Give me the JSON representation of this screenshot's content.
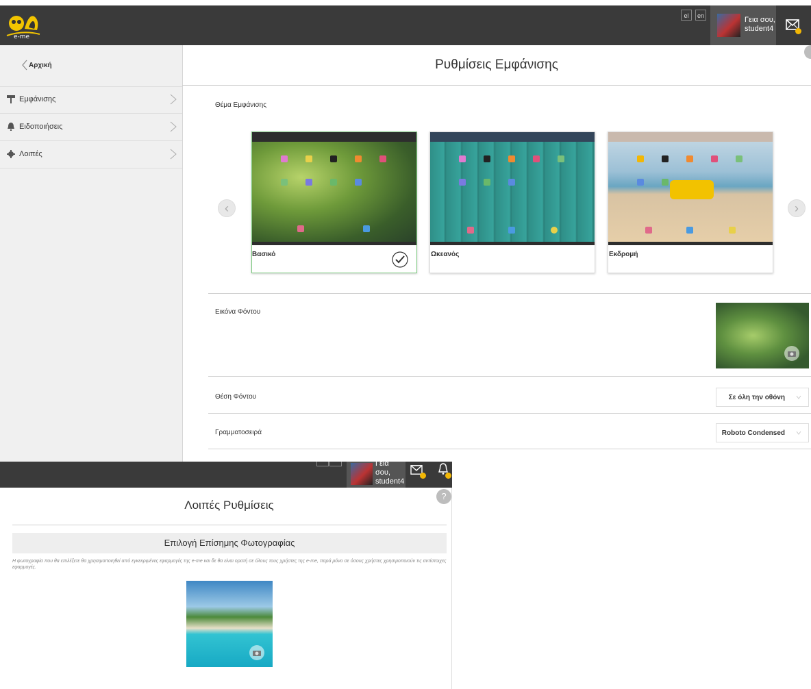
{
  "top_screen": {
    "logo_text": "e-me",
    "lang_buttons": [
      "el",
      "en"
    ],
    "user_greeting_line1": "Γεια σου,",
    "user_greeting_line2": "student4",
    "sidebar": {
      "back_label": "Αρχική",
      "items": [
        {
          "label": "Εμφάνισης",
          "icon": "paint-roller-icon"
        },
        {
          "label": "Ειδοποιήσεις",
          "icon": "bell-icon"
        },
        {
          "label": "Λοιπές",
          "icon": "gear-icon"
        }
      ]
    },
    "page_title": "Ρυθμίσεις Εμφάνισης",
    "theme_section_label": "Θέμα Εμφάνισης",
    "themes": [
      {
        "name": "Βασικό",
        "selected": true
      },
      {
        "name": "Ωκεανός",
        "selected": false
      },
      {
        "name": "Εκδρομή",
        "selected": false
      }
    ],
    "background_image_label": "Εικόνα Φόντου",
    "background_position_label": "Θέση Φόντου",
    "background_position_value": "Σε όλη την οθόνη",
    "font_label": "Γραμματοσειρά",
    "font_value": "Roboto Condensed"
  },
  "bottom_screen": {
    "user_greeting_line1": "Γεια σου,",
    "user_greeting_line2": "student4",
    "page_title": "Λοιπές Ρυθμίσεις",
    "help_symbol": "?",
    "official_photo_header": "Επιλογή Επίσημης Φωτογραφίας",
    "official_photo_description": "Η φωτογραφία που θα επιλέξετε θα χρησιμοποιηθεί από εγκεκριμένες εφαρμογές της e-me και δε θα είναι ορατή σε όλους τους χρήστες της e-me, παρά μόνο σε όσους χρήστες χρησιμοποιούν τις αντίστοιχες εφαρμογές."
  },
  "colors": {
    "topbar": "#3a3a3a",
    "sidebar": "#f0f0f0",
    "selected_border": "#7bc97e",
    "badge": "#f2b705"
  }
}
